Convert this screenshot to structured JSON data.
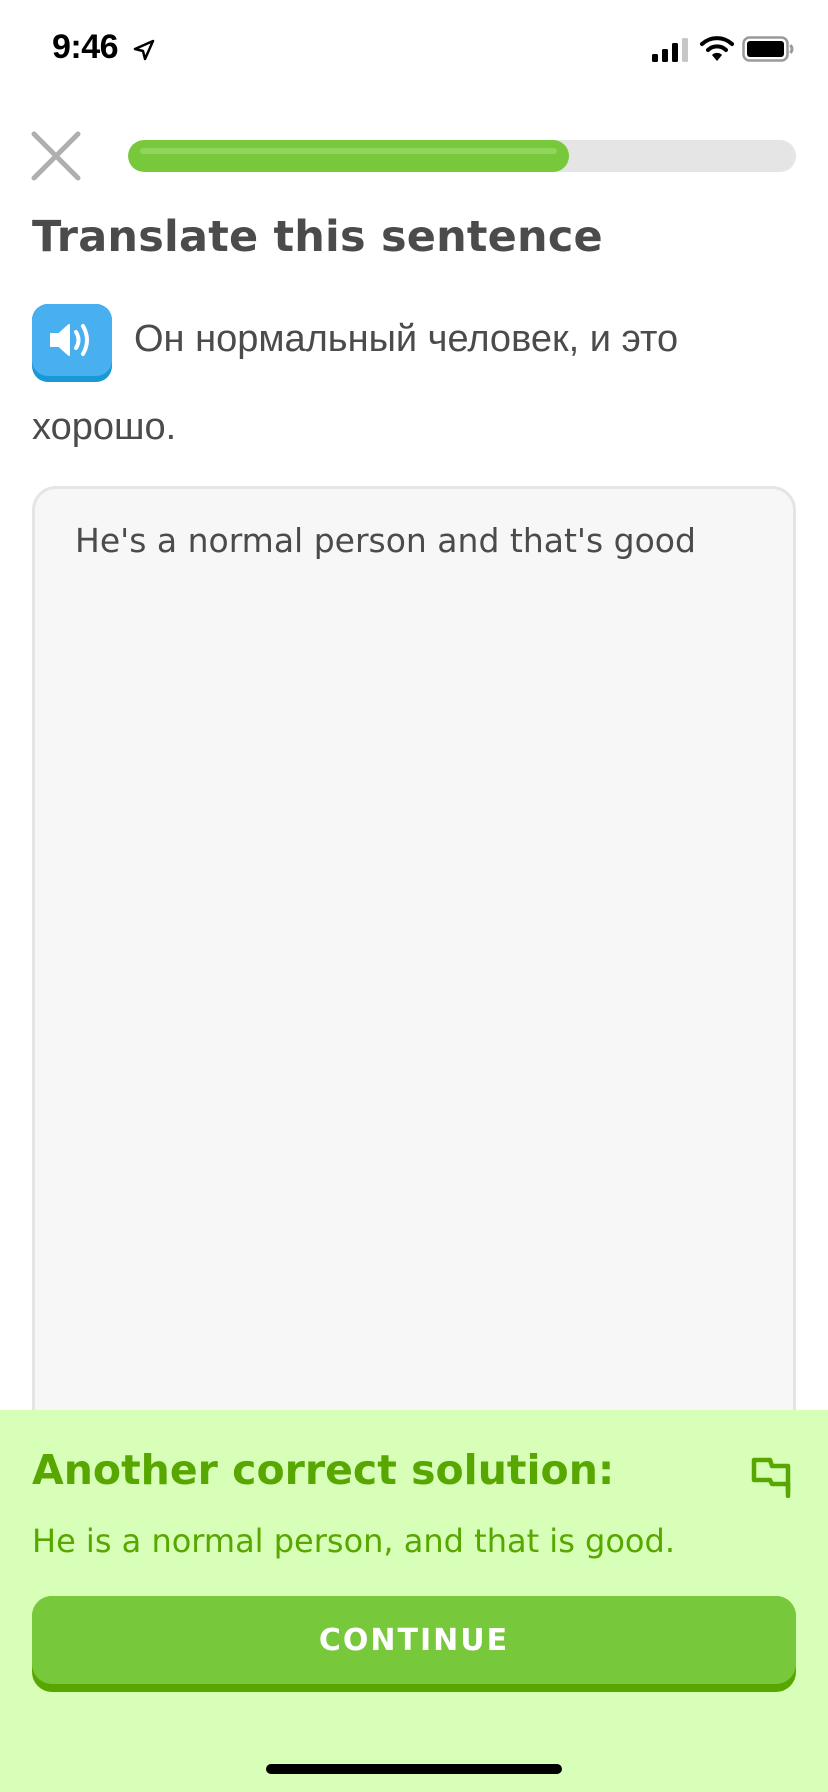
{
  "status_bar": {
    "time": "9:46",
    "icons": [
      "location-arrow-icon",
      "cellular-signal-icon",
      "wifi-icon",
      "battery-icon"
    ]
  },
  "header": {
    "close_icon": "close-icon",
    "progress": 0.66
  },
  "exercise": {
    "title": "Translate this sentence",
    "speaker_icon": "speaker-icon",
    "prompt_line1": "Он нормальный человек, и это",
    "prompt_line2": "хорошо.",
    "answer_value": "He's a normal person and that's good"
  },
  "feedback": {
    "title": "Another correct solution:",
    "solution": "He is a normal person, and that is good.",
    "flag_icon": "flag-icon",
    "continue_label": "CONTINUE"
  },
  "colors": {
    "progress_green": "#78c83c",
    "speaker_blue": "#49b0f0",
    "feedback_bg": "#d7ffb8",
    "feedback_text": "#58a700"
  }
}
